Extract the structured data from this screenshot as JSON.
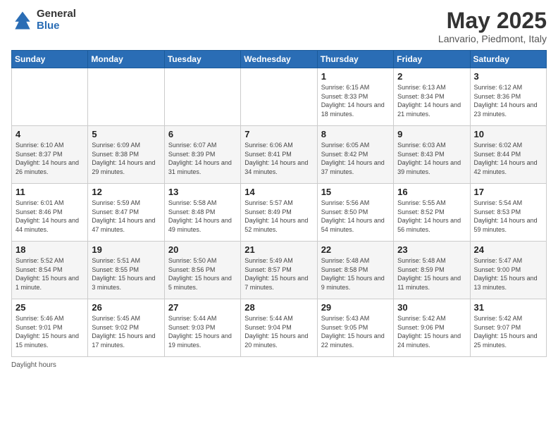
{
  "header": {
    "logo_general": "General",
    "logo_blue": "Blue",
    "title": "May 2025",
    "subtitle": "Lanvario, Piedmont, Italy"
  },
  "days_of_week": [
    "Sunday",
    "Monday",
    "Tuesday",
    "Wednesday",
    "Thursday",
    "Friday",
    "Saturday"
  ],
  "weeks": [
    [
      {
        "day": "",
        "sunrise": "",
        "sunset": "",
        "daylight": ""
      },
      {
        "day": "",
        "sunrise": "",
        "sunset": "",
        "daylight": ""
      },
      {
        "day": "",
        "sunrise": "",
        "sunset": "",
        "daylight": ""
      },
      {
        "day": "",
        "sunrise": "",
        "sunset": "",
        "daylight": ""
      },
      {
        "day": "1",
        "sunrise": "6:15 AM",
        "sunset": "8:33 PM",
        "daylight": "14 hours and 18 minutes."
      },
      {
        "day": "2",
        "sunrise": "6:13 AM",
        "sunset": "8:34 PM",
        "daylight": "14 hours and 21 minutes."
      },
      {
        "day": "3",
        "sunrise": "6:12 AM",
        "sunset": "8:36 PM",
        "daylight": "14 hours and 23 minutes."
      }
    ],
    [
      {
        "day": "4",
        "sunrise": "6:10 AM",
        "sunset": "8:37 PM",
        "daylight": "14 hours and 26 minutes."
      },
      {
        "day": "5",
        "sunrise": "6:09 AM",
        "sunset": "8:38 PM",
        "daylight": "14 hours and 29 minutes."
      },
      {
        "day": "6",
        "sunrise": "6:07 AM",
        "sunset": "8:39 PM",
        "daylight": "14 hours and 31 minutes."
      },
      {
        "day": "7",
        "sunrise": "6:06 AM",
        "sunset": "8:41 PM",
        "daylight": "14 hours and 34 minutes."
      },
      {
        "day": "8",
        "sunrise": "6:05 AM",
        "sunset": "8:42 PM",
        "daylight": "14 hours and 37 minutes."
      },
      {
        "day": "9",
        "sunrise": "6:03 AM",
        "sunset": "8:43 PM",
        "daylight": "14 hours and 39 minutes."
      },
      {
        "day": "10",
        "sunrise": "6:02 AM",
        "sunset": "8:44 PM",
        "daylight": "14 hours and 42 minutes."
      }
    ],
    [
      {
        "day": "11",
        "sunrise": "6:01 AM",
        "sunset": "8:46 PM",
        "daylight": "14 hours and 44 minutes."
      },
      {
        "day": "12",
        "sunrise": "5:59 AM",
        "sunset": "8:47 PM",
        "daylight": "14 hours and 47 minutes."
      },
      {
        "day": "13",
        "sunrise": "5:58 AM",
        "sunset": "8:48 PM",
        "daylight": "14 hours and 49 minutes."
      },
      {
        "day": "14",
        "sunrise": "5:57 AM",
        "sunset": "8:49 PM",
        "daylight": "14 hours and 52 minutes."
      },
      {
        "day": "15",
        "sunrise": "5:56 AM",
        "sunset": "8:50 PM",
        "daylight": "14 hours and 54 minutes."
      },
      {
        "day": "16",
        "sunrise": "5:55 AM",
        "sunset": "8:52 PM",
        "daylight": "14 hours and 56 minutes."
      },
      {
        "day": "17",
        "sunrise": "5:54 AM",
        "sunset": "8:53 PM",
        "daylight": "14 hours and 59 minutes."
      }
    ],
    [
      {
        "day": "18",
        "sunrise": "5:52 AM",
        "sunset": "8:54 PM",
        "daylight": "15 hours and 1 minute."
      },
      {
        "day": "19",
        "sunrise": "5:51 AM",
        "sunset": "8:55 PM",
        "daylight": "15 hours and 3 minutes."
      },
      {
        "day": "20",
        "sunrise": "5:50 AM",
        "sunset": "8:56 PM",
        "daylight": "15 hours and 5 minutes."
      },
      {
        "day": "21",
        "sunrise": "5:49 AM",
        "sunset": "8:57 PM",
        "daylight": "15 hours and 7 minutes."
      },
      {
        "day": "22",
        "sunrise": "5:48 AM",
        "sunset": "8:58 PM",
        "daylight": "15 hours and 9 minutes."
      },
      {
        "day": "23",
        "sunrise": "5:48 AM",
        "sunset": "8:59 PM",
        "daylight": "15 hours and 11 minutes."
      },
      {
        "day": "24",
        "sunrise": "5:47 AM",
        "sunset": "9:00 PM",
        "daylight": "15 hours and 13 minutes."
      }
    ],
    [
      {
        "day": "25",
        "sunrise": "5:46 AM",
        "sunset": "9:01 PM",
        "daylight": "15 hours and 15 minutes."
      },
      {
        "day": "26",
        "sunrise": "5:45 AM",
        "sunset": "9:02 PM",
        "daylight": "15 hours and 17 minutes."
      },
      {
        "day": "27",
        "sunrise": "5:44 AM",
        "sunset": "9:03 PM",
        "daylight": "15 hours and 19 minutes."
      },
      {
        "day": "28",
        "sunrise": "5:44 AM",
        "sunset": "9:04 PM",
        "daylight": "15 hours and 20 minutes."
      },
      {
        "day": "29",
        "sunrise": "5:43 AM",
        "sunset": "9:05 PM",
        "daylight": "15 hours and 22 minutes."
      },
      {
        "day": "30",
        "sunrise": "5:42 AM",
        "sunset": "9:06 PM",
        "daylight": "15 hours and 24 minutes."
      },
      {
        "day": "31",
        "sunrise": "5:42 AM",
        "sunset": "9:07 PM",
        "daylight": "15 hours and 25 minutes."
      }
    ]
  ],
  "footer": "Daylight hours"
}
